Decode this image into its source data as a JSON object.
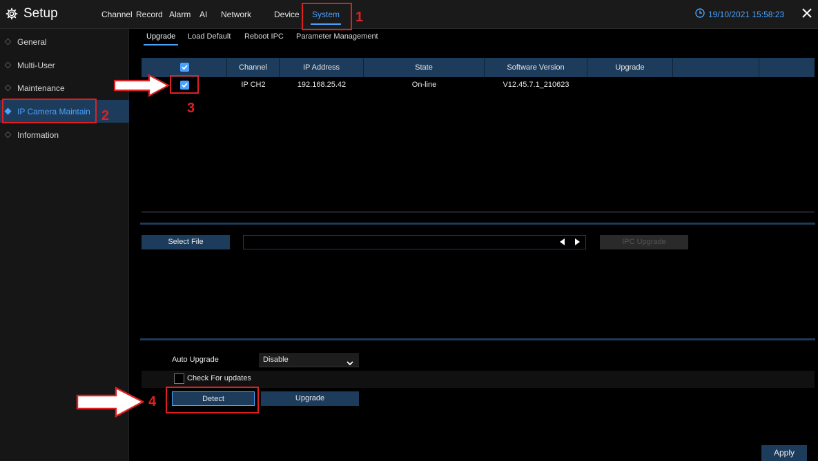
{
  "header": {
    "title": "Setup",
    "tabs": [
      {
        "label": "Channel"
      },
      {
        "label": "Record"
      },
      {
        "label": "Alarm"
      },
      {
        "label": "AI"
      },
      {
        "label": "Network"
      },
      {
        "label": "Device"
      },
      {
        "label": "System",
        "active": true
      }
    ],
    "datetime": "19/10/2021 15:58:23"
  },
  "sidebar": {
    "items": [
      {
        "label": "General"
      },
      {
        "label": "Multi-User"
      },
      {
        "label": "Maintenance"
      },
      {
        "label": "IP Camera Maintain",
        "active": true
      },
      {
        "label": "Information"
      }
    ]
  },
  "subtabs": [
    {
      "label": "Upgrade",
      "active": true
    },
    {
      "label": "Load Default"
    },
    {
      "label": "Reboot IPC"
    },
    {
      "label": "Parameter Management"
    }
  ],
  "table": {
    "columns": [
      "Channel",
      "IP Address",
      "State",
      "Software Version",
      "Upgrade"
    ],
    "rows": [
      {
        "channel": "IP CH2",
        "ip": "192.168.25.42",
        "state": "On-line",
        "version": "V12.45.7.1_210623",
        "upgrade": "",
        "checked": true
      }
    ]
  },
  "file": {
    "select_label": "Select File",
    "path": "",
    "ipc_upgrade_label": "IPC Upgrade"
  },
  "auto_upgrade": {
    "label": "Auto Upgrade",
    "value": "Disable",
    "check_label": "Check For updates",
    "detect_label": "Detect",
    "upgrade_label": "Upgrade"
  },
  "apply_label": "Apply",
  "annotations": [
    "1",
    "2",
    "3",
    "4"
  ],
  "colors": {
    "accent": "#4aa3ff",
    "header_bg": "#1d3c5c",
    "annotation": "#e02020"
  }
}
